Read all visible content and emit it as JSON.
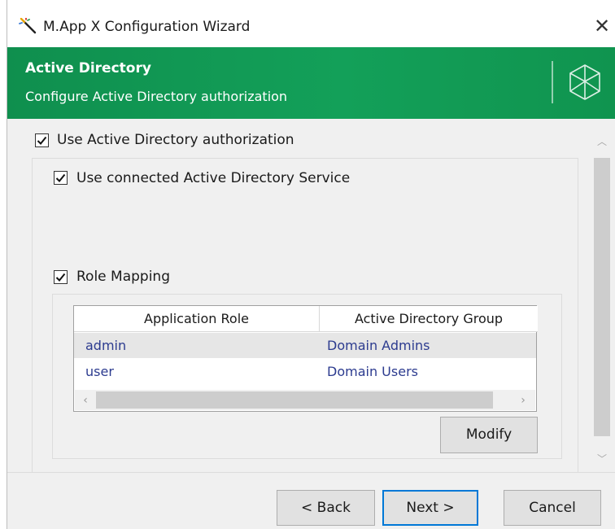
{
  "window": {
    "title": "M.App X Configuration Wizard",
    "close_glyph": "✕",
    "app_icon": "magic-wand-icon"
  },
  "banner": {
    "title": "Active Directory",
    "subtitle": "Configure Active Directory authorization",
    "logo": "hexagon-logo",
    "color": "#13a059"
  },
  "options": {
    "use_ad_auth": {
      "label": "Use Active Directory authorization",
      "checked": true
    },
    "use_connected_service": {
      "label": "Use connected Active Directory Service",
      "checked": true
    },
    "role_mapping": {
      "label": "Role Mapping",
      "checked": true
    }
  },
  "role_table": {
    "columns": [
      "Application Role",
      "Active Directory Group"
    ],
    "rows": [
      {
        "role": "admin",
        "group": "Domain Admins",
        "selected": true
      },
      {
        "role": "user",
        "group": "Domain Users",
        "selected": false
      }
    ],
    "scroll_left_glyph": "‹",
    "scroll_right_glyph": "›"
  },
  "modify_button": "Modify",
  "scrollbar": {
    "up_glyph": "︿",
    "down_glyph": "﹀"
  },
  "footer": {
    "back_label": "< Back",
    "next_label": "Next >",
    "cancel_label": "Cancel"
  }
}
